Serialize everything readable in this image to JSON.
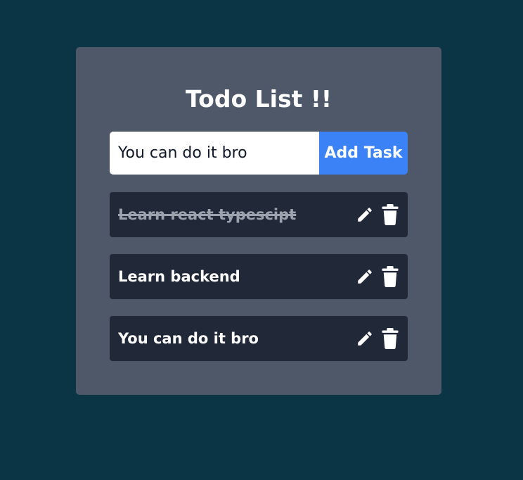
{
  "app": {
    "title": "Todo List !!"
  },
  "input": {
    "value": "You can do it bro",
    "placeholder": ""
  },
  "add_button": {
    "label": "Add Task"
  },
  "tasks": [
    {
      "text": "Learn react typescipt",
      "completed": true,
      "edit_icon": "pencil-icon",
      "delete_icon": "trash-icon"
    },
    {
      "text": "Learn backend",
      "completed": false,
      "edit_icon": "pencil-icon",
      "delete_icon": "trash-icon"
    },
    {
      "text": "You can do it bro",
      "completed": false,
      "edit_icon": "pencil-icon",
      "delete_icon": "trash-icon"
    }
  ],
  "colors": {
    "background": "#0b3544",
    "card": "#4f5869",
    "task_bg": "#212938",
    "accent": "#3b82f6",
    "done_text": "#9ca3af"
  }
}
